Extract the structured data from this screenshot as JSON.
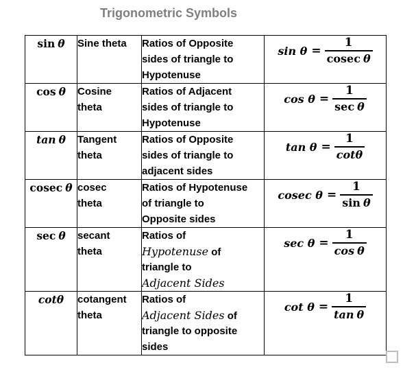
{
  "title": "Trigonometric Symbols",
  "rows": [
    {
      "symbol": {
        "func": "sin",
        "var": "θ",
        "italic": false
      },
      "name_lines": [
        "Sine theta"
      ],
      "description_lines": [
        [
          {
            "text": "Ratios of Opposite"
          }
        ],
        [
          {
            "text": "sides of triangle to"
          }
        ],
        [
          {
            "text": "Hypotenuse"
          }
        ]
      ],
      "formula": {
        "lhs": "sin θ",
        "equals": "=",
        "numerator": "1",
        "denominator": {
          "func": "cosec",
          "var": "θ",
          "italic": false
        }
      }
    },
    {
      "symbol": {
        "func": "cos",
        "var": "θ",
        "italic": false
      },
      "name_lines": [
        "Cosine",
        "theta"
      ],
      "description_lines": [
        [
          {
            "text": "Ratios of Adjacent"
          }
        ],
        [
          {
            "text": "sides of triangle to"
          }
        ],
        [
          {
            "text": "Hypotenuse"
          }
        ]
      ],
      "formula": {
        "lhs": "cos θ",
        "equals": "=",
        "numerator": "1",
        "denominator": {
          "func": "sec",
          "var": "θ",
          "italic": false
        }
      }
    },
    {
      "symbol": {
        "func": "tan",
        "var": "θ",
        "italic": true
      },
      "name_lines": [
        "Tangent",
        "theta"
      ],
      "description_lines": [
        [
          {
            "text": "Ratios of Opposite"
          }
        ],
        [
          {
            "text": "sides of triangle to"
          }
        ],
        [
          {
            "text": "adjacent sides"
          }
        ]
      ],
      "formula": {
        "lhs": "tan θ",
        "equals": "=",
        "numerator": "1",
        "denominator": {
          "func": "cot",
          "var": "θ",
          "italic": true
        }
      }
    },
    {
      "symbol": {
        "func": "cosec",
        "var": "θ",
        "italic": false
      },
      "name_lines": [
        "cosec",
        "theta"
      ],
      "description_lines": [
        [
          {
            "text": "Ratios of Hypotenuse"
          }
        ],
        [
          {
            "text": "of triangle to"
          }
        ],
        [
          {
            "text": "Opposite sides"
          }
        ]
      ],
      "formula": {
        "lhs": "cosec θ",
        "equals": "=",
        "numerator": "1",
        "denominator": {
          "func": "sin",
          "var": "θ",
          "italic": false
        }
      }
    },
    {
      "symbol": {
        "func": "sec",
        "var": "θ",
        "italic": false
      },
      "name_lines": [
        "secant",
        "theta"
      ],
      "description_lines": [
        [
          {
            "text": "Ratios of"
          }
        ],
        [
          {
            "text": "Hypotenuse",
            "math": true
          },
          {
            "text": " of"
          }
        ],
        [
          {
            "text": "triangle to"
          }
        ],
        [
          {
            "text": "Adjacent Sides",
            "math": true
          }
        ]
      ],
      "formula": {
        "lhs": "sec θ",
        "equals": "=",
        "numerator": "1",
        "denominator": {
          "func": "cos",
          "var": "θ",
          "italic": true
        }
      }
    },
    {
      "symbol": {
        "func": "cot",
        "var": "θ",
        "italic": true
      },
      "name_lines": [
        "cotangent",
        "theta"
      ],
      "description_lines": [
        [
          {
            "text": "Ratios of"
          }
        ],
        [
          {
            "text": "Adjacent Sides",
            "math": true
          },
          {
            "text": " of"
          }
        ],
        [
          {
            "text": "triangle to opposite"
          }
        ],
        [
          {
            "text": "sides"
          }
        ]
      ],
      "formula": {
        "lhs": "cot θ",
        "equals": "=",
        "numerator": "1",
        "denominator": {
          "func": "tan",
          "var": "θ",
          "italic": true
        }
      }
    }
  ],
  "colors": {
    "title": "#7f7f7f",
    "border": "#000000",
    "checkbox_border": "#bdbdbd"
  }
}
